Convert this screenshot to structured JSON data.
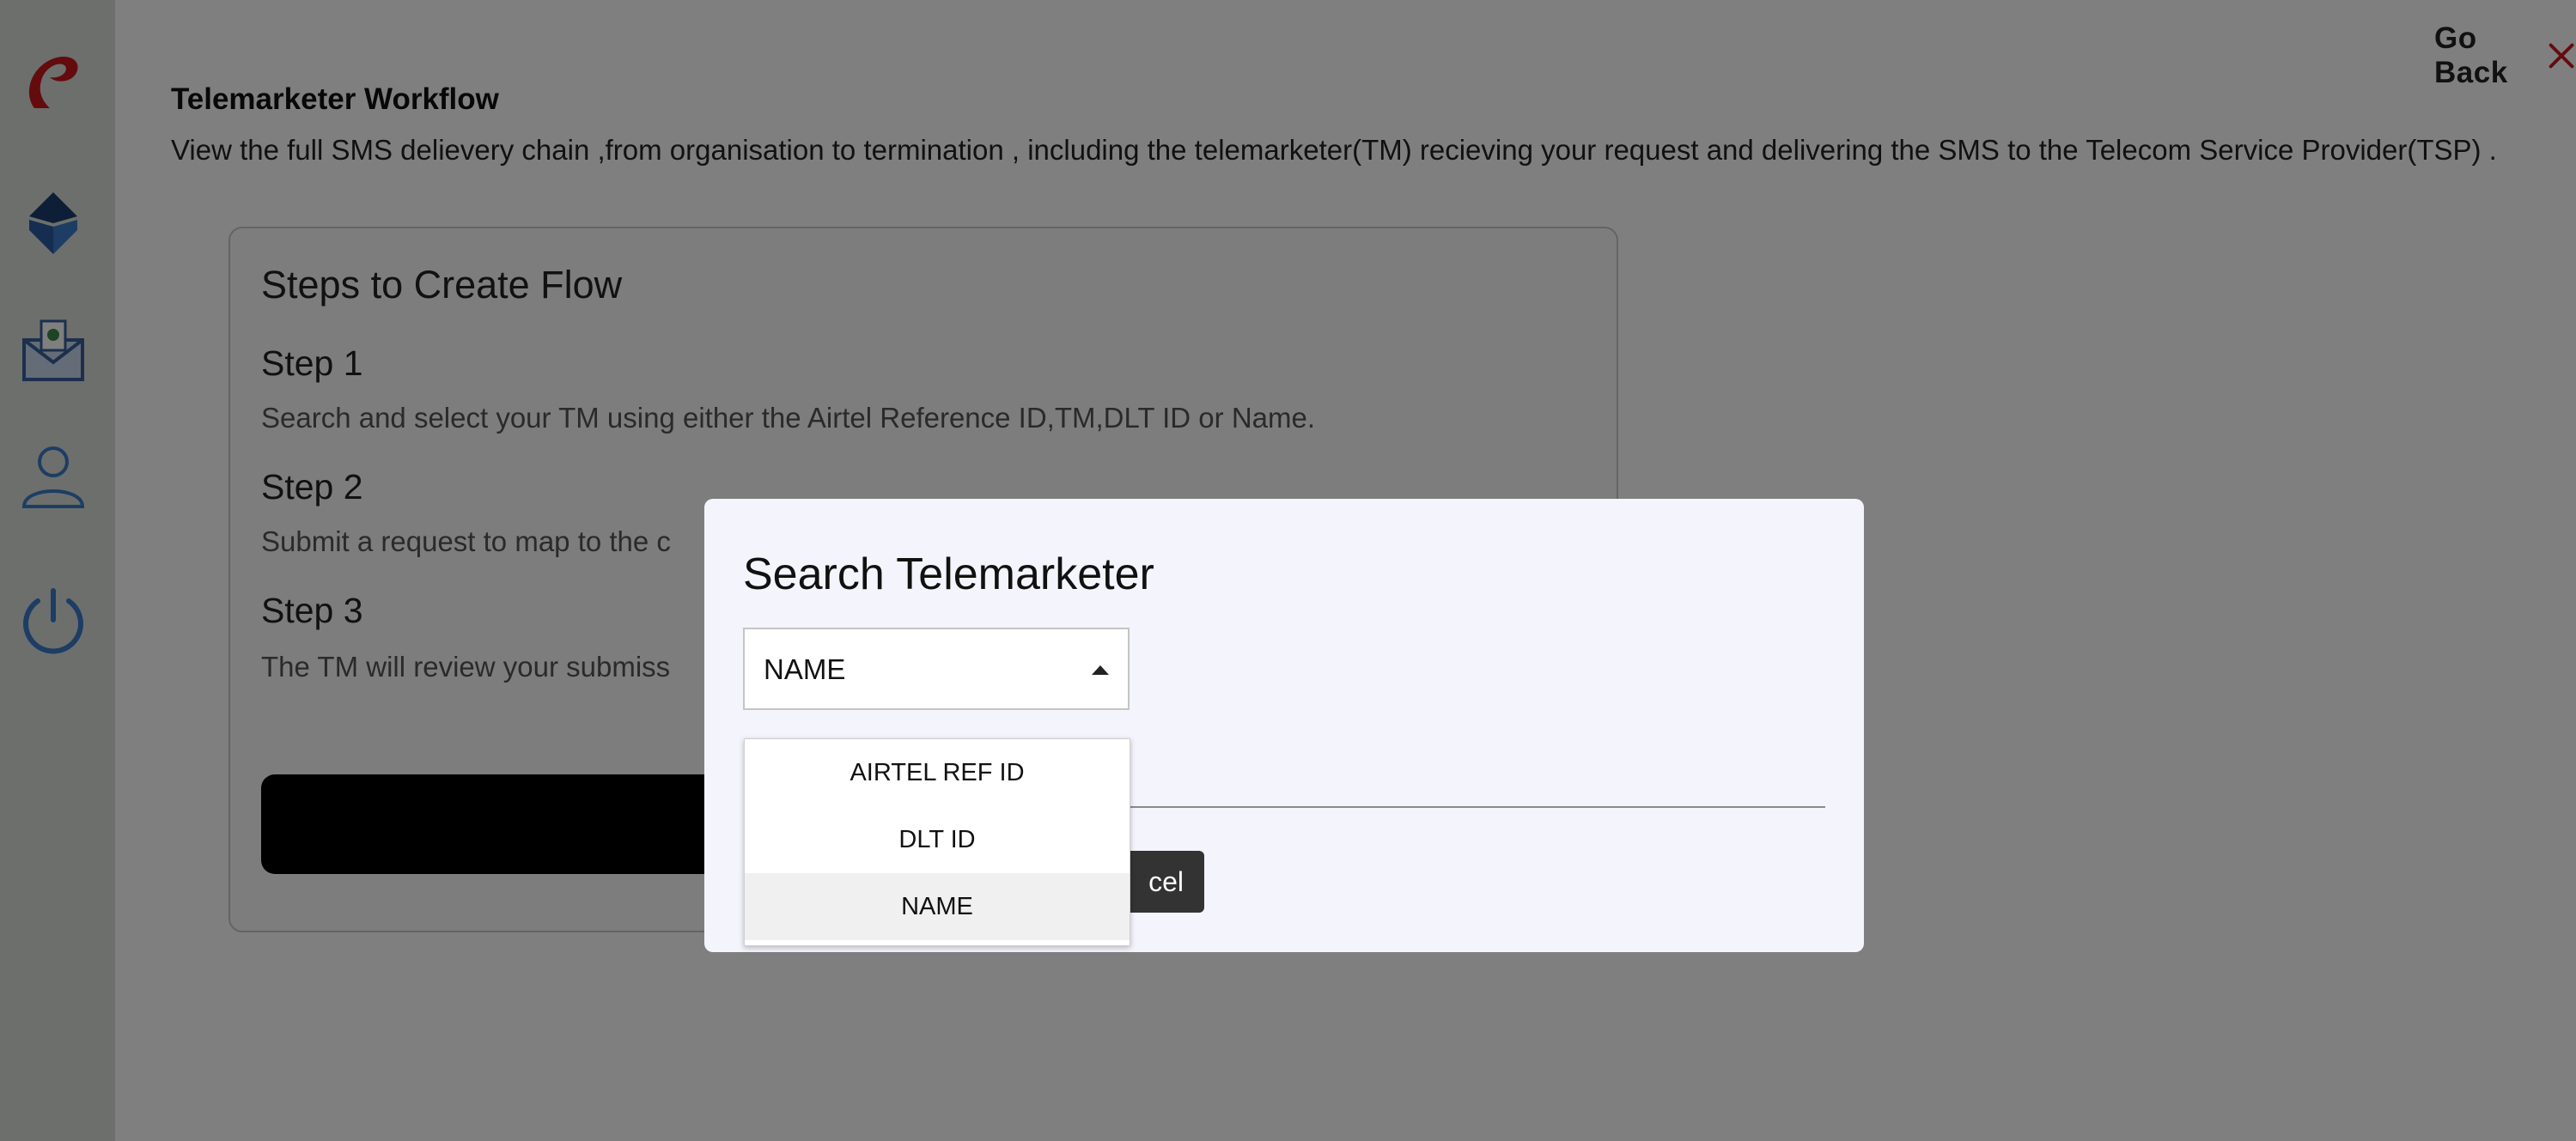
{
  "header": {
    "go_back_label": "Go Back",
    "page_title": "Telemarketer Workflow",
    "page_description": "View the full SMS delievery chain ,from organisation to termination , including the telemarketer(TM) recieving your request and delivering the SMS to the Telecom Service Provider(TSP) ."
  },
  "steps": {
    "title": "Steps to Create Flow",
    "items": [
      {
        "heading": "Step 1",
        "text": "Search and select your TM using either the Airtel Reference ID,TM,DLT ID or Name."
      },
      {
        "heading": "Step 2",
        "text": "Submit a request to map to the c"
      },
      {
        "heading": "Step 3",
        "text": "The TM will review your submiss"
      }
    ]
  },
  "modal": {
    "title": "Search Telemarketer",
    "select_value": "NAME",
    "cancel_label": "cel",
    "options": [
      "AIRTEL REF ID",
      "DLT ID",
      "NAME"
    ]
  },
  "sidebar": {
    "icons": [
      "airtel-logo-icon",
      "layers-icon",
      "mail-icon",
      "user-icon",
      "power-icon"
    ]
  },
  "colors": {
    "accent_red": "#c8161d",
    "sidebar_bg": "#d8dfd9",
    "icon_blue": "#3a7bc8"
  }
}
